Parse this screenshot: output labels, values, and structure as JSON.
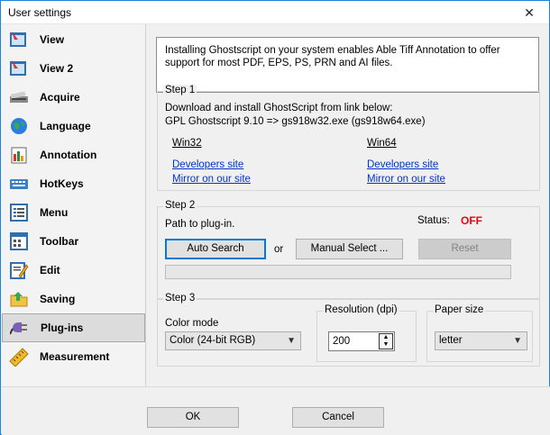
{
  "window": {
    "title": "User settings"
  },
  "sidebar": {
    "items": [
      {
        "label": "View",
        "icon": "view-icon"
      },
      {
        "label": "View 2",
        "icon": "view2-icon"
      },
      {
        "label": "Acquire",
        "icon": "scanner-icon"
      },
      {
        "label": "Language",
        "icon": "globe-icon"
      },
      {
        "label": "Annotation",
        "icon": "annotation-icon"
      },
      {
        "label": "HotKeys",
        "icon": "keyboard-icon"
      },
      {
        "label": "Menu",
        "icon": "menu-icon"
      },
      {
        "label": "Toolbar",
        "icon": "toolbar-icon"
      },
      {
        "label": "Edit",
        "icon": "edit-icon"
      },
      {
        "label": "Saving",
        "icon": "saving-icon"
      },
      {
        "label": "Plug-ins",
        "icon": "plugins-icon",
        "selected": true
      },
      {
        "label": "Measurement",
        "icon": "ruler-icon"
      }
    ]
  },
  "info_text": "Installing Ghostscript on your system enables Able Tiff Annotation to offer support for most PDF, EPS, PS, PRN and AI files.",
  "step1": {
    "title": "Step 1",
    "line1": "Download and install GhostScript from link below:",
    "line2": "GPL Ghostscript 9.10 => gs918w32.exe (gs918w64.exe)",
    "win32": {
      "heading": "Win32",
      "dev_link": "Developers site",
      "mirror_link": "Mirror on our site"
    },
    "win64": {
      "heading": "Win64",
      "dev_link": "Developers site",
      "mirror_link": "Mirror on our site"
    }
  },
  "step2": {
    "title": "Step 2",
    "path_label": "Path to plug-in.",
    "status_label": "Status:",
    "status_value": "OFF",
    "status_color": "#e30613",
    "auto_search": "Auto Search",
    "or": "or",
    "manual_select": "Manual Select ...",
    "reset": "Reset",
    "path_progress": 0
  },
  "step3": {
    "title": "Step 3",
    "color_mode_label": "Color mode",
    "color_mode_value": "Color (24-bit RGB)",
    "resolution_label": "Resolution (dpi)",
    "resolution_value": "200",
    "paper_label": "Paper size",
    "paper_value": "letter"
  },
  "footer": {
    "ok": "OK",
    "cancel": "Cancel"
  },
  "colors": {
    "accent": "#0078d7",
    "link": "#0033cc"
  }
}
